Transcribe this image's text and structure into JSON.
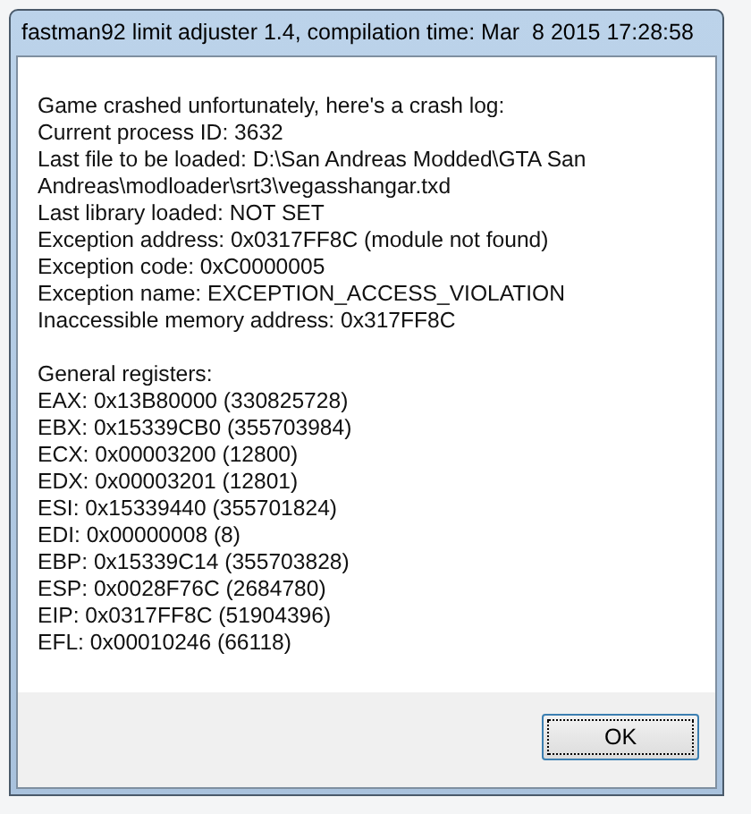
{
  "window": {
    "title": "fastman92 limit adjuster 1.4, compilation time: Mar  8 2015 17:28:58"
  },
  "sections": [
    {
      "lines": [
        "Game crashed unfortunately, here's a crash log:",
        "Current process ID: 3632",
        "Last file to be loaded: D:\\San Andreas Modded\\GTA San",
        "Andreas\\modloader\\srt3\\vegasshangar.txd",
        "Last library loaded: NOT SET",
        "Exception address: 0x0317FF8C (module not found)",
        "Exception code: 0xC0000005",
        "Exception name: EXCEPTION_ACCESS_VIOLATION",
        "Inaccessible memory address: 0x317FF8C"
      ]
    },
    {
      "lines": [
        "General registers:",
        "EAX: 0x13B80000 (330825728)",
        "EBX: 0x15339CB0 (355703984)",
        "ECX: 0x00003200 (12800)",
        "EDX: 0x00003201 (12801)",
        "ESI: 0x15339440 (355701824)",
        "EDI: 0x00000008 (8)",
        "EBP: 0x15339C14 (355703828)",
        "ESP: 0x0028F76C (2684780)",
        "EIP: 0x0317FF8C (51904396)",
        "EFL: 0x00010246 (66118)"
      ]
    }
  ],
  "buttons": [
    {
      "label": "OK",
      "focused": true
    }
  ]
}
